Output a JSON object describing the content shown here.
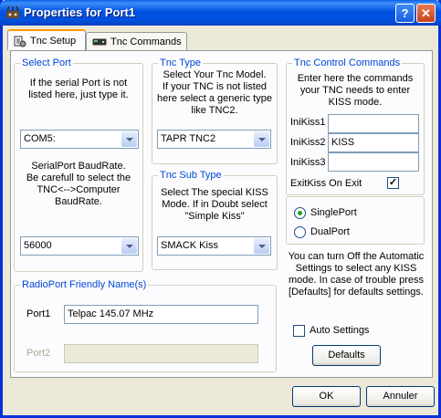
{
  "window": {
    "title": "Properties for Port1",
    "help_glyph": "?",
    "close_glyph": "✕"
  },
  "tabs": [
    {
      "label": "Tnc Setup",
      "active": true
    },
    {
      "label": "Tnc Commands",
      "active": false
    }
  ],
  "select_port": {
    "legend": "Select Port",
    "hint_line1": "If the serial Port is not",
    "hint_line2": "listed here, just type it.",
    "port_value": "COM5:",
    "baud_hint_line1": "SerialPort BaudRate.",
    "baud_hint_line2": "Be carefull to select the",
    "baud_hint_line3": "TNC<-->Computer",
    "baud_hint_line4": "BaudRate.",
    "baud_value": "56000"
  },
  "tnc_type": {
    "legend": "Tnc Type",
    "hint_line1": "Select Your Tnc Model.",
    "hint_line2": "If your TNC is not listed",
    "hint_line3": "here select a generic type",
    "hint_line4": "like TNC2.",
    "value": "TAPR TNC2"
  },
  "tnc_sub_type": {
    "legend": "Tnc Sub Type",
    "hint_line1": "Select The special KISS",
    "hint_line2": "Mode. If in Doubt select",
    "hint_line3": "\"Simple Kiss\"",
    "value": "SMACK Kiss"
  },
  "control_commands": {
    "legend": "Tnc Control Commands",
    "hint_line1": "Enter here the commands",
    "hint_line2": "your TNC needs to enter",
    "hint_line3": "KISS mode.",
    "inikiss1_label": "IniKiss1",
    "inikiss1_value": "",
    "inikiss2_label": "IniKiss2",
    "inikiss2_value": "KISS",
    "inikiss3_label": "IniKiss3",
    "inikiss3_value": "",
    "exitkiss_label": "ExitKiss On Exit",
    "exitkiss_checked": true,
    "exitkiss_glyph": "✓"
  },
  "port_mode": {
    "single_label": "SinglePort",
    "single_selected": true,
    "dual_label": "DualPort",
    "dual_selected": false
  },
  "auto_settings": {
    "hint_line1": "You can turn Off the Automatic",
    "hint_line2": "Settings to select any KISS",
    "hint_line3": "mode. In case of trouble press",
    "hint_line4": "[Defaults] for defaults settings.",
    "checkbox_label": "Auto Settings",
    "checked": false,
    "defaults_label": "Defaults"
  },
  "friendly_names": {
    "legend": "RadioPort Friendly Name(s)",
    "port1_label": "Port1",
    "port1_value": "Telpac 145.07 MHz",
    "port2_label": "Port2",
    "port2_value": ""
  },
  "footer": {
    "ok_label": "OK",
    "cancel_label": "Annuler"
  }
}
